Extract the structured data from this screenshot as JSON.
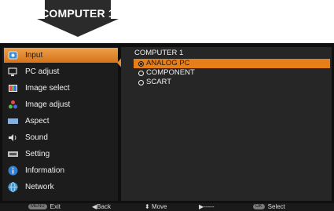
{
  "banner": {
    "label": "COMPUTER 1"
  },
  "menu": {
    "items": [
      {
        "label": "Input",
        "icon": "input-icon",
        "selected": true
      },
      {
        "label": "PC adjust",
        "icon": "pc-adjust-icon"
      },
      {
        "label": "Image select",
        "icon": "image-select-icon"
      },
      {
        "label": "Image adjust",
        "icon": "image-adjust-icon"
      },
      {
        "label": "Aspect",
        "icon": "aspect-icon"
      },
      {
        "label": "Sound",
        "icon": "sound-icon"
      },
      {
        "label": "Setting",
        "icon": "setting-icon"
      },
      {
        "label": "Information",
        "icon": "information-icon"
      },
      {
        "label": "Network",
        "icon": "network-icon"
      }
    ]
  },
  "submenu": {
    "title": "COMPUTER 1",
    "options": [
      {
        "label": "ANALOG PC",
        "selected": true
      },
      {
        "label": "COMPONENT",
        "selected": false
      },
      {
        "label": "SCART",
        "selected": false
      }
    ]
  },
  "footer": {
    "exit_label": "Exit",
    "back_label": "Back",
    "move_label": "Move",
    "next_label": "-----",
    "select_label": "Select",
    "ok_key": "OK",
    "menu_key": "MENU"
  },
  "colors": {
    "accent": "#e77f18",
    "banner": "#2a2a2a",
    "panel": "#0f0f0f"
  }
}
